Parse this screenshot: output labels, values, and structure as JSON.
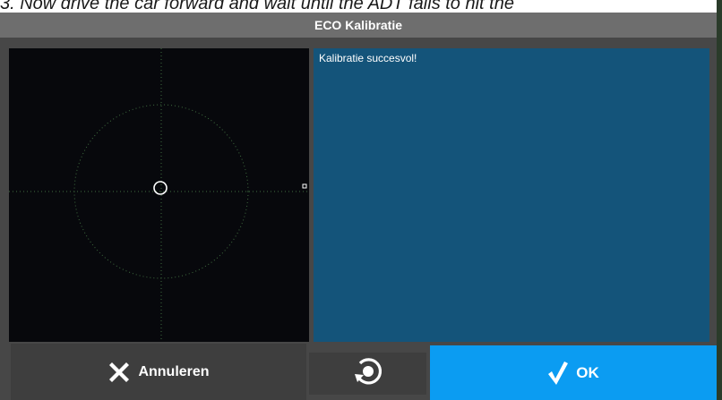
{
  "background": {
    "caption": "3. Now drive the car forward and wait until the ADT fails to hit the"
  },
  "dialog": {
    "title": "ECO Kalibratie",
    "message": "Kalibratie succesvol!",
    "buttons": {
      "cancel_label": "Annuleren",
      "cancel_icon": "close-x-icon",
      "recalibrate_icon": "rotate-refresh-icon",
      "ok_label": "OK",
      "ok_icon": "checkmark-icon"
    }
  },
  "colors": {
    "title_bar": "#6e6e6e",
    "graph_background": "#07080c",
    "message_panel": "#14547a",
    "ok_button": "#0b9cf2",
    "neutral_button": "#3e3e3e",
    "crosshair": "#3f6b3f"
  }
}
